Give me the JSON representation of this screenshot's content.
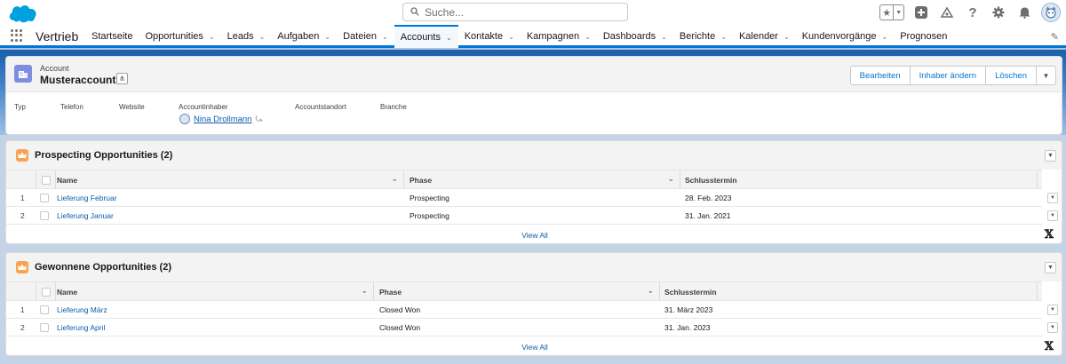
{
  "header": {
    "search_placeholder": "Suche..."
  },
  "navbar": {
    "app_name": "Vertrieb",
    "items": [
      {
        "label": "Startseite",
        "dropdown": false,
        "active": false
      },
      {
        "label": "Opportunities",
        "dropdown": true,
        "active": false
      },
      {
        "label": "Leads",
        "dropdown": true,
        "active": false
      },
      {
        "label": "Aufgaben",
        "dropdown": true,
        "active": false
      },
      {
        "label": "Dateien",
        "dropdown": true,
        "active": false
      },
      {
        "label": "Accounts",
        "dropdown": true,
        "active": true
      },
      {
        "label": "Kontakte",
        "dropdown": true,
        "active": false
      },
      {
        "label": "Kampagnen",
        "dropdown": true,
        "active": false
      },
      {
        "label": "Dashboards",
        "dropdown": true,
        "active": false
      },
      {
        "label": "Berichte",
        "dropdown": true,
        "active": false
      },
      {
        "label": "Kalender",
        "dropdown": true,
        "active": false
      },
      {
        "label": "Kundenvorgänge",
        "dropdown": true,
        "active": false
      },
      {
        "label": "Prognosen",
        "dropdown": false,
        "active": false
      }
    ]
  },
  "record": {
    "type_label": "Account",
    "name": "Musteraccount",
    "actions": [
      "Bearbeiten",
      "Inhaber ändern",
      "Löschen"
    ],
    "field_labels": {
      "typ": "Typ",
      "telefon": "Telefon",
      "website": "Website",
      "owner": "Accountinhaber",
      "standort": "Accountstandort",
      "branche": "Branche"
    },
    "owner_name": "Nina Drollmann"
  },
  "lists": [
    {
      "title": "Prospecting Opportunities (2)",
      "columns": [
        "Name",
        "Phase",
        "Schlusstermin"
      ],
      "rows": [
        {
          "num": "1",
          "name": "Lieferung Februar",
          "phase": "Prospecting",
          "date": "28. Feb. 2023"
        },
        {
          "num": "2",
          "name": "Lieferung Januar",
          "phase": "Prospecting",
          "date": "31. Jan. 2021"
        }
      ],
      "view_all": "View All"
    },
    {
      "title": "Gewonnene Opportunities (2)",
      "columns": [
        "Name",
        "Phase",
        "Schlusstermin"
      ],
      "rows": [
        {
          "num": "1",
          "name": "Lieferung März",
          "phase": "Closed Won",
          "date": "31. März 2023"
        },
        {
          "num": "2",
          "name": "Lieferung April",
          "phase": "Closed Won",
          "date": "31. Jan. 2023"
        }
      ],
      "view_all": "View All"
    }
  ],
  "colors": {
    "brand": "#0176d3",
    "link": "#0b5cab",
    "account_icon": "#7f8de1",
    "opportunity_icon": "#f7a452"
  },
  "icons": [
    "salesforce-cloud-icon",
    "search-icon",
    "favorites-star-icon",
    "add-icon",
    "trailhead-icon",
    "help-icon",
    "setup-gear-icon",
    "notifications-bell-icon",
    "user-avatar-icon",
    "app-launcher-icon",
    "edit-nav-pencil-icon",
    "account-icon",
    "hierarchy-icon",
    "crown-opportunity-icon",
    "x-logo-icon"
  ]
}
